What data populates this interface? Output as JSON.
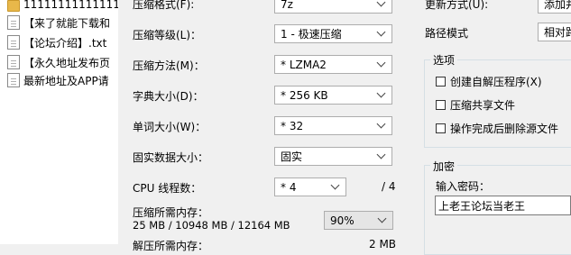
{
  "filelist": {
    "items": [
      {
        "name": "11111111111111",
        "type": "folder"
      },
      {
        "name": "【来了就能下载和",
        "type": "doc"
      },
      {
        "name": "【论坛介绍】.txt",
        "type": "doc"
      },
      {
        "name": "【永久地址发布页",
        "type": "doc"
      },
      {
        "name": "最新地址及APP请",
        "type": "doc"
      }
    ]
  },
  "dialog": {
    "format_label": "压缩格式(F):",
    "format_value": "7z",
    "level_label": "压缩等级(L)：",
    "level_value": "1 - 极速压缩",
    "method_label": "压缩方法(M)：",
    "method_value": "* LZMA2",
    "dict_label": "字典大小(D)：",
    "dict_value": "* 256 KB",
    "word_label": "单词大小(W)：",
    "word_value": "* 32",
    "solid_label": "固实数据大小：",
    "solid_value": "固实",
    "threads_label": "CPU 线程数：",
    "threads_value": "* 4",
    "threads_max": "/ 4",
    "mem_label": "压缩所需内存：",
    "mem_value": "25 MB / 10948 MB / 12164 MB",
    "mem_percent": "90%",
    "decomp_label": "解压所需内存：",
    "decomp_value": "2 MB",
    "update_label": "更新方式(U):",
    "update_value": "添加并",
    "path_label": "路径模式",
    "path_value": "相对路",
    "options_title": "选项",
    "opt_sfx": "创建自解压程序(X)",
    "opt_shared": "压缩共享文件",
    "opt_delete": "操作完成后删除源文件",
    "encrypt_title": "加密",
    "password_label": "输入密码：",
    "password_value": "上老王论坛当老王"
  }
}
